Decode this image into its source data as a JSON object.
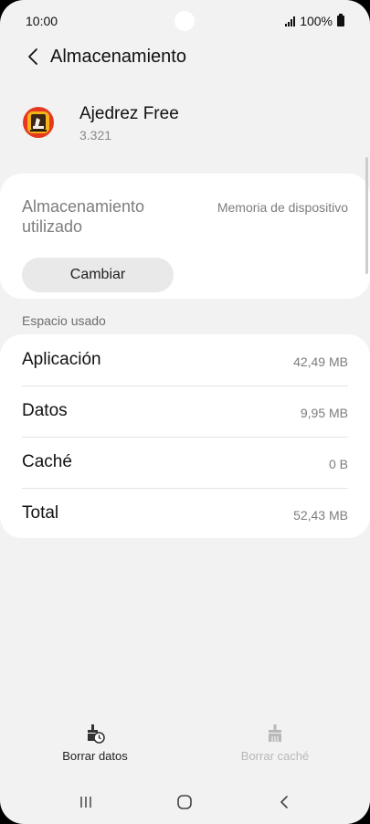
{
  "status_bar": {
    "time": "10:00",
    "battery": "100%"
  },
  "header": {
    "title": "Almacenamiento"
  },
  "app": {
    "name": "Ajedrez Free",
    "version": "3.321"
  },
  "storage": {
    "label": "Almacenamiento utilizado",
    "value": "Memoria de dispositivo",
    "change_label": "Cambiar"
  },
  "usage": {
    "section_title": "Espacio usado",
    "rows": [
      {
        "label": "Aplicación",
        "value": "42,49 MB"
      },
      {
        "label": "Datos",
        "value": "9,95 MB"
      },
      {
        "label": "Caché",
        "value": "0 B"
      },
      {
        "label": "Total",
        "value": "52,43 MB"
      }
    ]
  },
  "actions": {
    "clear_data": "Borrar datos",
    "clear_cache": "Borrar caché"
  },
  "icons": {
    "back": "chevron-left-icon",
    "clear_data": "broom-clock-icon",
    "clear_cache": "broom-icon",
    "recents": "recents-icon",
    "home": "home-icon",
    "nav_back": "back-icon"
  },
  "colors": {
    "background": "#f2f2f2",
    "card": "#ffffff",
    "disabled": "#b8b8b8"
  }
}
